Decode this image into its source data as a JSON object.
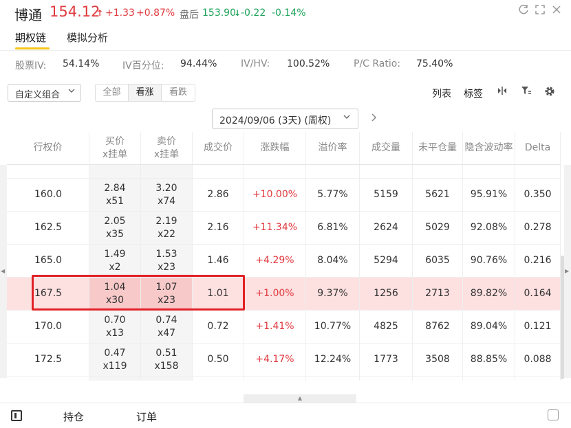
{
  "header": {
    "stock_name": "博通",
    "price": "154.12",
    "price_arrow": "↑",
    "change": "+1.33",
    "change_pct": "+0.87%",
    "after_hours_label": "盘后",
    "after_price": "153.90",
    "after_arrow": "↓",
    "after_change": "-0.22",
    "after_change_pct": "-0.14%"
  },
  "tabs": [
    {
      "label": "期权链",
      "active": true
    },
    {
      "label": "模拟分析",
      "active": false
    }
  ],
  "iv_bar": {
    "stock_iv_label": "股票IV:",
    "stock_iv": "54.14%",
    "iv_pct_label": "IV百分位:",
    "iv_pct": "94.44%",
    "ivhv_label": "IV/HV:",
    "ivhv": "100.52%",
    "pc_label": "P/C Ratio:",
    "pc": "75.40%"
  },
  "toolbar": {
    "combo": "自定义组合",
    "filters": [
      "全部",
      "看涨",
      "看跌"
    ],
    "active_filter": "看涨",
    "list_label": "列表",
    "tag_label": "标签"
  },
  "date_selector": {
    "value": "2024/09/06 (3天) (周权)"
  },
  "table": {
    "headers": [
      "行权价",
      "买价\nx挂单",
      "卖价\nx挂单",
      "成交价",
      "涨跌幅",
      "溢价率",
      "成交量",
      "未平仓量",
      "隐含波动率",
      "Delta"
    ],
    "rows": [
      {
        "strike": "160.0",
        "bid": "2.84",
        "bid_size": "x51",
        "ask": "3.20",
        "ask_size": "x74",
        "last": "2.86",
        "chg": "+10.00%",
        "premium": "5.77%",
        "volume": "5159",
        "oi": "5621",
        "iv": "95.91%",
        "delta": "0.350"
      },
      {
        "strike": "162.5",
        "bid": "2.05",
        "bid_size": "x35",
        "ask": "2.19",
        "ask_size": "x22",
        "last": "2.16",
        "chg": "+11.34%",
        "premium": "6.81%",
        "volume": "2624",
        "oi": "5029",
        "iv": "92.08%",
        "delta": "0.278"
      },
      {
        "strike": "165.0",
        "bid": "1.49",
        "bid_size": "x2",
        "ask": "1.53",
        "ask_size": "x23",
        "last": "1.46",
        "chg": "+4.29%",
        "premium": "8.04%",
        "volume": "5294",
        "oi": "6035",
        "iv": "90.76%",
        "delta": "0.216"
      },
      {
        "strike": "167.5",
        "bid": "1.04",
        "bid_size": "x30",
        "ask": "1.07",
        "ask_size": "x23",
        "last": "1.01",
        "chg": "+1.00%",
        "premium": "9.37%",
        "volume": "1256",
        "oi": "2713",
        "iv": "89.82%",
        "delta": "0.164",
        "selected": true
      },
      {
        "strike": "170.0",
        "bid": "0.70",
        "bid_size": "x13",
        "ask": "0.74",
        "ask_size": "x47",
        "last": "0.72",
        "chg": "+1.41%",
        "premium": "10.77%",
        "volume": "4825",
        "oi": "8762",
        "iv": "89.04%",
        "delta": "0.121"
      },
      {
        "strike": "172.5",
        "bid": "0.47",
        "bid_size": "x119",
        "ask": "0.51",
        "ask_size": "x158",
        "last": "0.50",
        "chg": "+4.17%",
        "premium": "12.24%",
        "volume": "1773",
        "oi": "3508",
        "iv": "88.85%",
        "delta": "0.088"
      }
    ]
  },
  "footer": {
    "positions": "持仓",
    "orders": "订单"
  },
  "colors": {
    "up": "#e0393e",
    "down": "#1ea35a",
    "accent": "#f5c518",
    "selected_row": "#fde0e0",
    "highlight": "#e12025"
  },
  "icons": [
    "refresh-icon",
    "expand-icon",
    "close-icon",
    "column-toggle-icon",
    "filter-icon",
    "settings-icon",
    "chevron-right-icon",
    "panel-icon",
    "copy-icon"
  ]
}
